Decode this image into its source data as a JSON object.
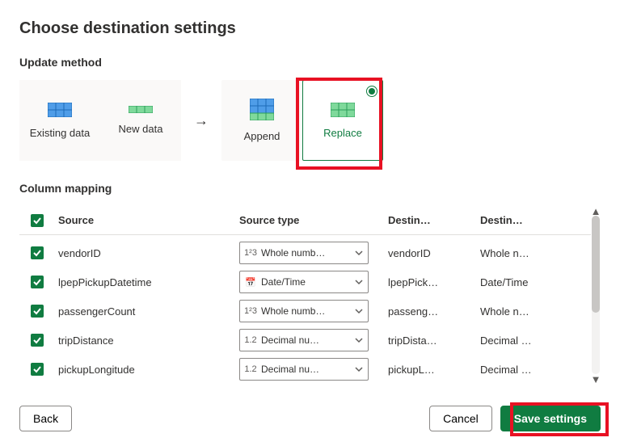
{
  "title": "Choose destination settings",
  "sections": {
    "update_method": "Update method",
    "column_mapping": "Column mapping"
  },
  "method": {
    "existing": "Existing data",
    "newdata": "New data",
    "append": "Append",
    "replace": "Replace",
    "selected": "replace"
  },
  "table": {
    "headers": {
      "source": "Source",
      "source_type": "Source type",
      "destination": "Destin…",
      "destination_type": "Destin…"
    },
    "rows": [
      {
        "checked": true,
        "source": "vendorID",
        "type_label": "Whole numb…",
        "type_icon": "num",
        "dest": "vendorID",
        "dest_type": "Whole n…"
      },
      {
        "checked": true,
        "source": "lpepPickupDatetime",
        "type_label": "Date/Time",
        "type_icon": "cal",
        "dest": "lpepPick…",
        "dest_type": "Date/Time"
      },
      {
        "checked": true,
        "source": "passengerCount",
        "type_label": "Whole numb…",
        "type_icon": "num",
        "dest": "passeng…",
        "dest_type": "Whole n…"
      },
      {
        "checked": true,
        "source": "tripDistance",
        "type_label": "Decimal nu…",
        "type_icon": "dec",
        "dest": "tripDista…",
        "dest_type": "Decimal …"
      },
      {
        "checked": true,
        "source": "pickupLongitude",
        "type_label": "Decimal nu…",
        "type_icon": "dec",
        "dest": "pickupL…",
        "dest_type": "Decimal …"
      }
    ]
  },
  "type_prefixes": {
    "num": "1²3",
    "dec": "1.2",
    "cal": "📅"
  },
  "buttons": {
    "back": "Back",
    "cancel": "Cancel",
    "save": "Save settings"
  },
  "colors": {
    "accent": "#107c41",
    "highlight": "#e81123"
  }
}
